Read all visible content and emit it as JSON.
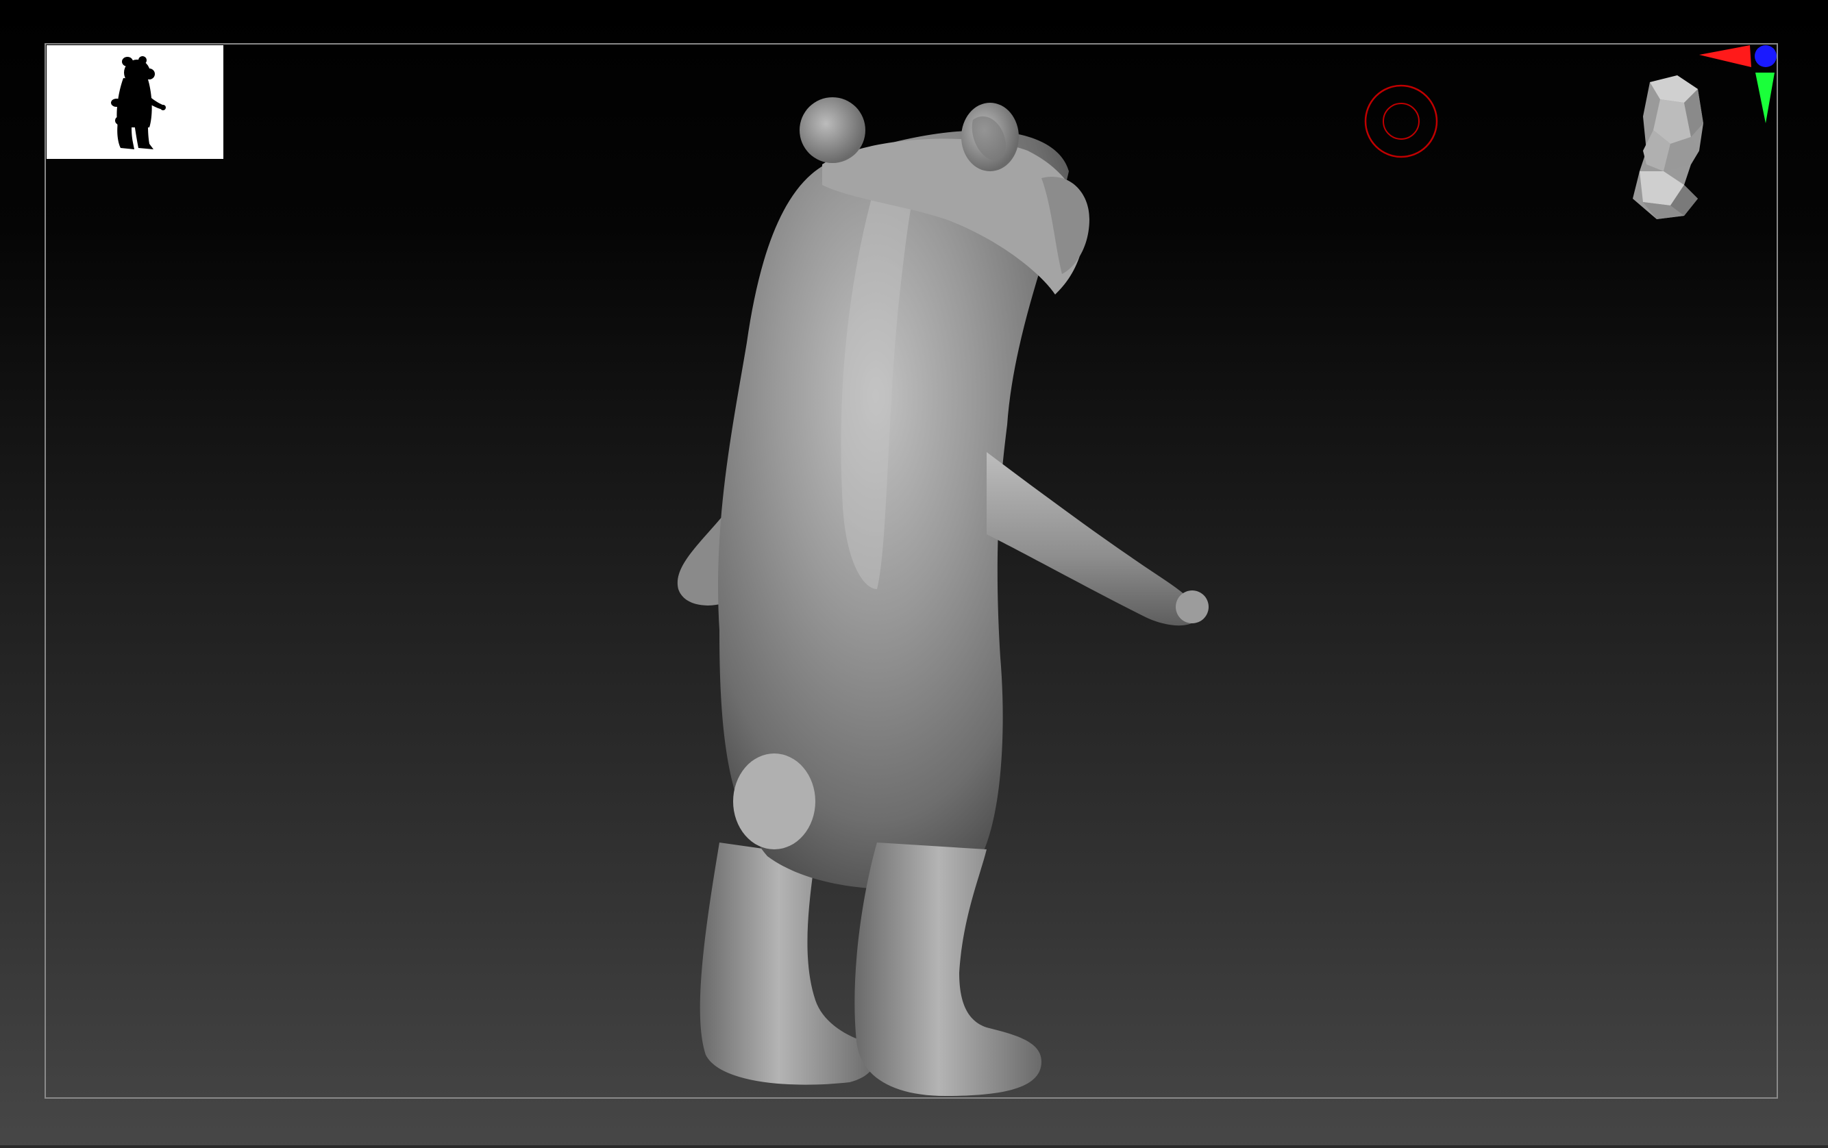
{
  "viewport": {
    "background_top": "#000000",
    "background_bottom": "#474747",
    "frame_color": "#8a8a8a"
  },
  "thumbnail": {
    "icon": "bear-silhouette-icon",
    "background": "#ffffff",
    "silhouette_color": "#000000"
  },
  "model": {
    "icon": "bear-sculpt-model",
    "base_color": "#8a8a8a",
    "highlight_color": "#c8c8c8",
    "shadow_color": "#3a3a3a"
  },
  "pivot_indicator": {
    "icon": "transpose-pivot-icon",
    "color": "#c00000"
  },
  "navigation_head": {
    "icon": "navigation-head-icon",
    "color": "#a8a8a8"
  },
  "axis_gizmo": {
    "icon": "axis-gizmo-icon",
    "x_color": "#ff1a1a",
    "y_color": "#1aff3a",
    "z_color": "#1a1aff"
  }
}
